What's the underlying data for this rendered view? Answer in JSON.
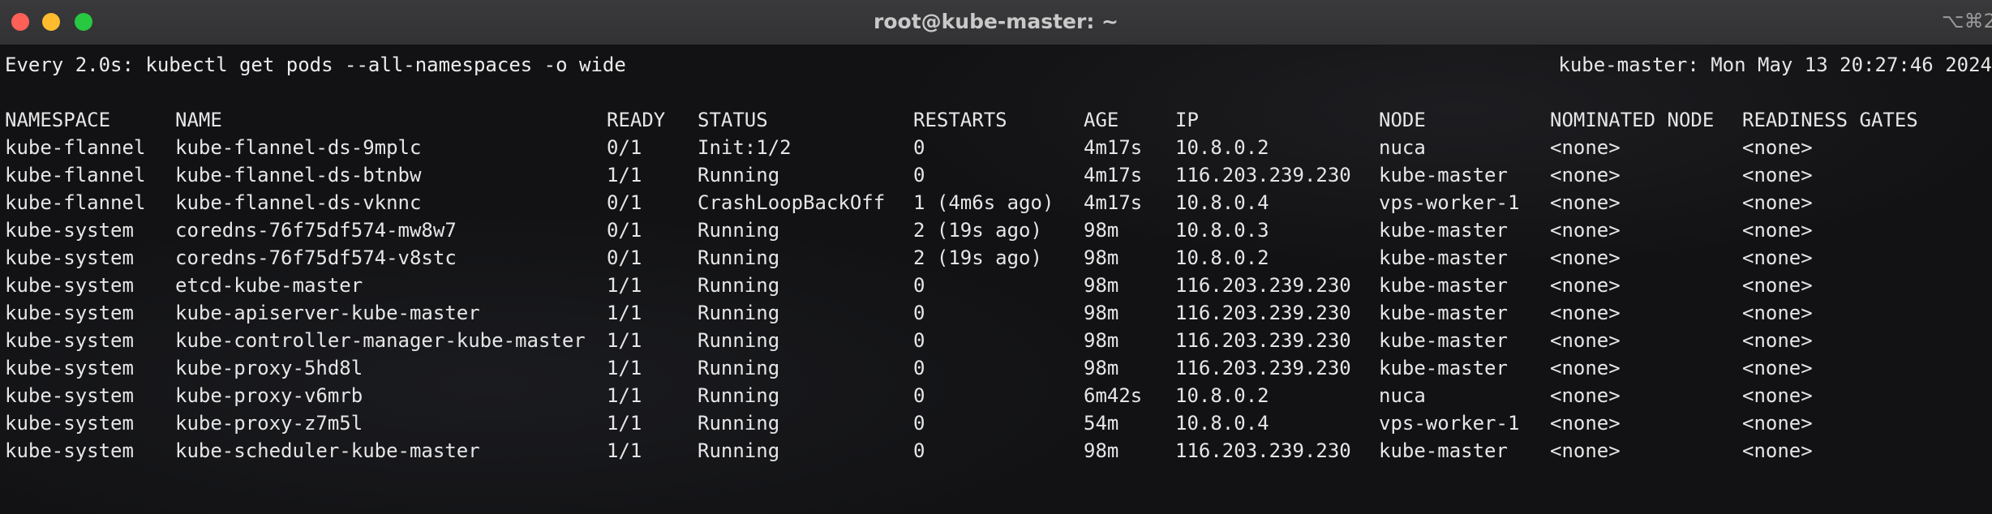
{
  "window": {
    "title": "root@kube-master: ~",
    "shortcut": "⌥⌘2"
  },
  "terminal": {
    "watch_header": "Every 2.0s: kubectl get pods --all-namespaces -o wide",
    "host_time": "kube-master: Mon May 13 20:27:46 2024",
    "columns": [
      "NAMESPACE",
      "NAME",
      "READY",
      "STATUS",
      "RESTARTS",
      "AGE",
      "IP",
      "NODE",
      "NOMINATED NODE",
      "READINESS GATES"
    ],
    "rows": [
      [
        "kube-flannel",
        "kube-flannel-ds-9mplc",
        "0/1",
        "Init:1/2",
        "0",
        "4m17s",
        "10.8.0.2",
        "nuca",
        "<none>",
        "<none>"
      ],
      [
        "kube-flannel",
        "kube-flannel-ds-btnbw",
        "1/1",
        "Running",
        "0",
        "4m17s",
        "116.203.239.230",
        "kube-master",
        "<none>",
        "<none>"
      ],
      [
        "kube-flannel",
        "kube-flannel-ds-vknnc",
        "0/1",
        "CrashLoopBackOff",
        "1 (4m6s ago)",
        "4m17s",
        "10.8.0.4",
        "vps-worker-1",
        "<none>",
        "<none>"
      ],
      [
        "kube-system",
        "coredns-76f75df574-mw8w7",
        "0/1",
        "Running",
        "2 (19s ago)",
        "98m",
        "10.8.0.3",
        "kube-master",
        "<none>",
        "<none>"
      ],
      [
        "kube-system",
        "coredns-76f75df574-v8stc",
        "0/1",
        "Running",
        "2 (19s ago)",
        "98m",
        "10.8.0.2",
        "kube-master",
        "<none>",
        "<none>"
      ],
      [
        "kube-system",
        "etcd-kube-master",
        "1/1",
        "Running",
        "0",
        "98m",
        "116.203.239.230",
        "kube-master",
        "<none>",
        "<none>"
      ],
      [
        "kube-system",
        "kube-apiserver-kube-master",
        "1/1",
        "Running",
        "0",
        "98m",
        "116.203.239.230",
        "kube-master",
        "<none>",
        "<none>"
      ],
      [
        "kube-system",
        "kube-controller-manager-kube-master",
        "1/1",
        "Running",
        "0",
        "98m",
        "116.203.239.230",
        "kube-master",
        "<none>",
        "<none>"
      ],
      [
        "kube-system",
        "kube-proxy-5hd8l",
        "1/1",
        "Running",
        "0",
        "98m",
        "116.203.239.230",
        "kube-master",
        "<none>",
        "<none>"
      ],
      [
        "kube-system",
        "kube-proxy-v6mrb",
        "1/1",
        "Running",
        "0",
        "6m42s",
        "10.8.0.2",
        "nuca",
        "<none>",
        "<none>"
      ],
      [
        "kube-system",
        "kube-proxy-z7m5l",
        "1/1",
        "Running",
        "0",
        "54m",
        "10.8.0.4",
        "vps-worker-1",
        "<none>",
        "<none>"
      ],
      [
        "kube-system",
        "kube-scheduler-kube-master",
        "1/1",
        "Running",
        "0",
        "98m",
        "116.203.239.230",
        "kube-master",
        "<none>",
        "<none>"
      ]
    ]
  },
  "colors": {
    "close": "#fe5f57",
    "minimize": "#febc2e",
    "zoom": "#28c840",
    "terminal_text": "#ececec"
  }
}
